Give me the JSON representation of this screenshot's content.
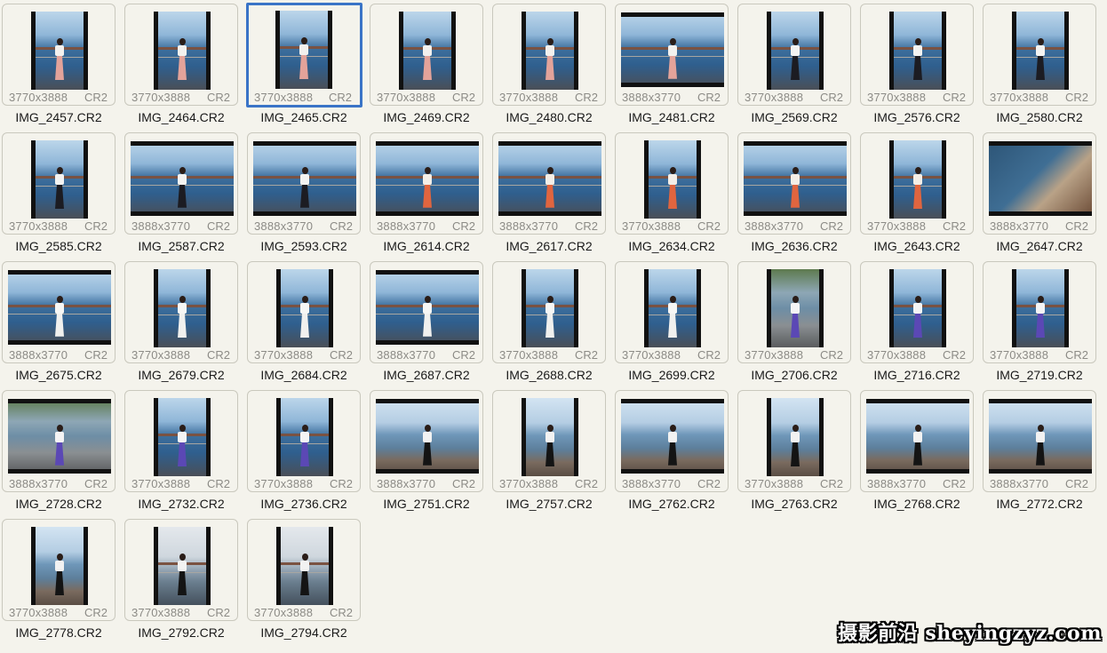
{
  "files": [
    {
      "name": "IMG_2457.CR2",
      "dims": "3770x3888",
      "type": "CR2",
      "orientation": "portrait",
      "scene": "sea",
      "outfit": "pink"
    },
    {
      "name": "IMG_2464.CR2",
      "dims": "3770x3888",
      "type": "CR2",
      "orientation": "portrait",
      "scene": "sea",
      "outfit": "pink"
    },
    {
      "name": "IMG_2465.CR2",
      "dims": "3770x3888",
      "type": "CR2",
      "orientation": "portrait",
      "scene": "sea",
      "outfit": "pink",
      "selected": true
    },
    {
      "name": "IMG_2469.CR2",
      "dims": "3770x3888",
      "type": "CR2",
      "orientation": "portrait",
      "scene": "sea",
      "outfit": "pink"
    },
    {
      "name": "IMG_2480.CR2",
      "dims": "3770x3888",
      "type": "CR2",
      "orientation": "portrait",
      "scene": "sea",
      "outfit": "pink"
    },
    {
      "name": "IMG_2481.CR2",
      "dims": "3888x3770",
      "type": "CR2",
      "orientation": "landscape",
      "scene": "sea",
      "outfit": "pink"
    },
    {
      "name": "IMG_2569.CR2",
      "dims": "3770x3888",
      "type": "CR2",
      "orientation": "portrait",
      "scene": "sea",
      "outfit": "dots"
    },
    {
      "name": "IMG_2576.CR2",
      "dims": "3770x3888",
      "type": "CR2",
      "orientation": "portrait",
      "scene": "sea",
      "outfit": "dots"
    },
    {
      "name": "IMG_2580.CR2",
      "dims": "3770x3888",
      "type": "CR2",
      "orientation": "portrait",
      "scene": "sea",
      "outfit": "dots"
    },
    {
      "name": "IMG_2585.CR2",
      "dims": "3770x3888",
      "type": "CR2",
      "orientation": "portrait",
      "scene": "sea",
      "outfit": "dots"
    },
    {
      "name": "IMG_2587.CR2",
      "dims": "3888x3770",
      "type": "CR2",
      "orientation": "landscape",
      "scene": "sea",
      "outfit": "dots"
    },
    {
      "name": "IMG_2593.CR2",
      "dims": "3888x3770",
      "type": "CR2",
      "orientation": "landscape",
      "scene": "sea",
      "outfit": "dots"
    },
    {
      "name": "IMG_2614.CR2",
      "dims": "3888x3770",
      "type": "CR2",
      "orientation": "landscape",
      "scene": "sea",
      "outfit": "orange"
    },
    {
      "name": "IMG_2617.CR2",
      "dims": "3888x3770",
      "type": "CR2",
      "orientation": "landscape",
      "scene": "sea",
      "outfit": "orange"
    },
    {
      "name": "IMG_2634.CR2",
      "dims": "3770x3888",
      "type": "CR2",
      "orientation": "portrait",
      "scene": "sea",
      "outfit": "orange"
    },
    {
      "name": "IMG_2636.CR2",
      "dims": "3888x3770",
      "type": "CR2",
      "orientation": "landscape",
      "scene": "sea",
      "outfit": "orange"
    },
    {
      "name": "IMG_2643.CR2",
      "dims": "3770x3888",
      "type": "CR2",
      "orientation": "portrait",
      "scene": "sea",
      "outfit": "orange"
    },
    {
      "name": "IMG_2647.CR2",
      "dims": "3888x3770",
      "type": "CR2",
      "orientation": "landscape",
      "scene": "close",
      "outfit": "white"
    },
    {
      "name": "IMG_2675.CR2",
      "dims": "3888x3770",
      "type": "CR2",
      "orientation": "landscape",
      "scene": "sea",
      "outfit": "white"
    },
    {
      "name": "IMG_2679.CR2",
      "dims": "3770x3888",
      "type": "CR2",
      "orientation": "portrait",
      "scene": "sea",
      "outfit": "white"
    },
    {
      "name": "IMG_2684.CR2",
      "dims": "3770x3888",
      "type": "CR2",
      "orientation": "portrait",
      "scene": "sea",
      "outfit": "white"
    },
    {
      "name": "IMG_2687.CR2",
      "dims": "3888x3770",
      "type": "CR2",
      "orientation": "landscape",
      "scene": "sea",
      "outfit": "white"
    },
    {
      "name": "IMG_2688.CR2",
      "dims": "3770x3888",
      "type": "CR2",
      "orientation": "portrait",
      "scene": "sea",
      "outfit": "white"
    },
    {
      "name": "IMG_2699.CR2",
      "dims": "3770x3888",
      "type": "CR2",
      "orientation": "portrait",
      "scene": "sea",
      "outfit": "white"
    },
    {
      "name": "IMG_2706.CR2",
      "dims": "3770x3888",
      "type": "CR2",
      "orientation": "portrait",
      "scene": "park",
      "outfit": "purple"
    },
    {
      "name": "IMG_2716.CR2",
      "dims": "3770x3888",
      "type": "CR2",
      "orientation": "portrait",
      "scene": "sea",
      "outfit": "purple"
    },
    {
      "name": "IMG_2719.CR2",
      "dims": "3770x3888",
      "type": "CR2",
      "orientation": "portrait",
      "scene": "sea",
      "outfit": "purple"
    },
    {
      "name": "IMG_2728.CR2",
      "dims": "3888x3770",
      "type": "CR2",
      "orientation": "landscape",
      "scene": "park",
      "outfit": "purple"
    },
    {
      "name": "IMG_2732.CR2",
      "dims": "3770x3888",
      "type": "CR2",
      "orientation": "portrait",
      "scene": "sea",
      "outfit": "purple"
    },
    {
      "name": "IMG_2736.CR2",
      "dims": "3770x3888",
      "type": "CR2",
      "orientation": "portrait",
      "scene": "sea",
      "outfit": "purple"
    },
    {
      "name": "IMG_2751.CR2",
      "dims": "3888x3770",
      "type": "CR2",
      "orientation": "landscape",
      "scene": "rock",
      "outfit": "black"
    },
    {
      "name": "IMG_2757.CR2",
      "dims": "3770x3888",
      "type": "CR2",
      "orientation": "portrait",
      "scene": "rock",
      "outfit": "black"
    },
    {
      "name": "IMG_2762.CR2",
      "dims": "3888x3770",
      "type": "CR2",
      "orientation": "landscape",
      "scene": "rock",
      "outfit": "black"
    },
    {
      "name": "IMG_2763.CR2",
      "dims": "3770x3888",
      "type": "CR2",
      "orientation": "portrait",
      "scene": "rock",
      "outfit": "black"
    },
    {
      "name": "IMG_2768.CR2",
      "dims": "3888x3770",
      "type": "CR2",
      "orientation": "landscape",
      "scene": "rock",
      "outfit": "black"
    },
    {
      "name": "IMG_2772.CR2",
      "dims": "3888x3770",
      "type": "CR2",
      "orientation": "landscape",
      "scene": "rock",
      "outfit": "black"
    },
    {
      "name": "IMG_2778.CR2",
      "dims": "3770x3888",
      "type": "CR2",
      "orientation": "portrait",
      "scene": "rock",
      "outfit": "black"
    },
    {
      "name": "IMG_2792.CR2",
      "dims": "3770x3888",
      "type": "CR2",
      "orientation": "portrait",
      "scene": "city",
      "outfit": "black"
    },
    {
      "name": "IMG_2794.CR2",
      "dims": "3770x3888",
      "type": "CR2",
      "orientation": "portrait",
      "scene": "city",
      "outfit": "black"
    }
  ],
  "outfit_colors": {
    "pink": {
      "top": "#f3f1ee",
      "bottom": "#e3a39a"
    },
    "dots": {
      "top": "#f3f3f1",
      "bottom": "#1c1c22"
    },
    "orange": {
      "top": "#f4eee6",
      "bottom": "#e0653f"
    },
    "white": {
      "top": "#f6f6f4",
      "bottom": "#f0f0ee"
    },
    "purple": {
      "top": "#f4f4f4",
      "bottom": "#5b48b5"
    },
    "black": {
      "top": "#f2f2f2",
      "bottom": "#141414"
    }
  },
  "selection_color": "#3a74c7",
  "watermark": "摄影前沿 sheyingzyz.com"
}
